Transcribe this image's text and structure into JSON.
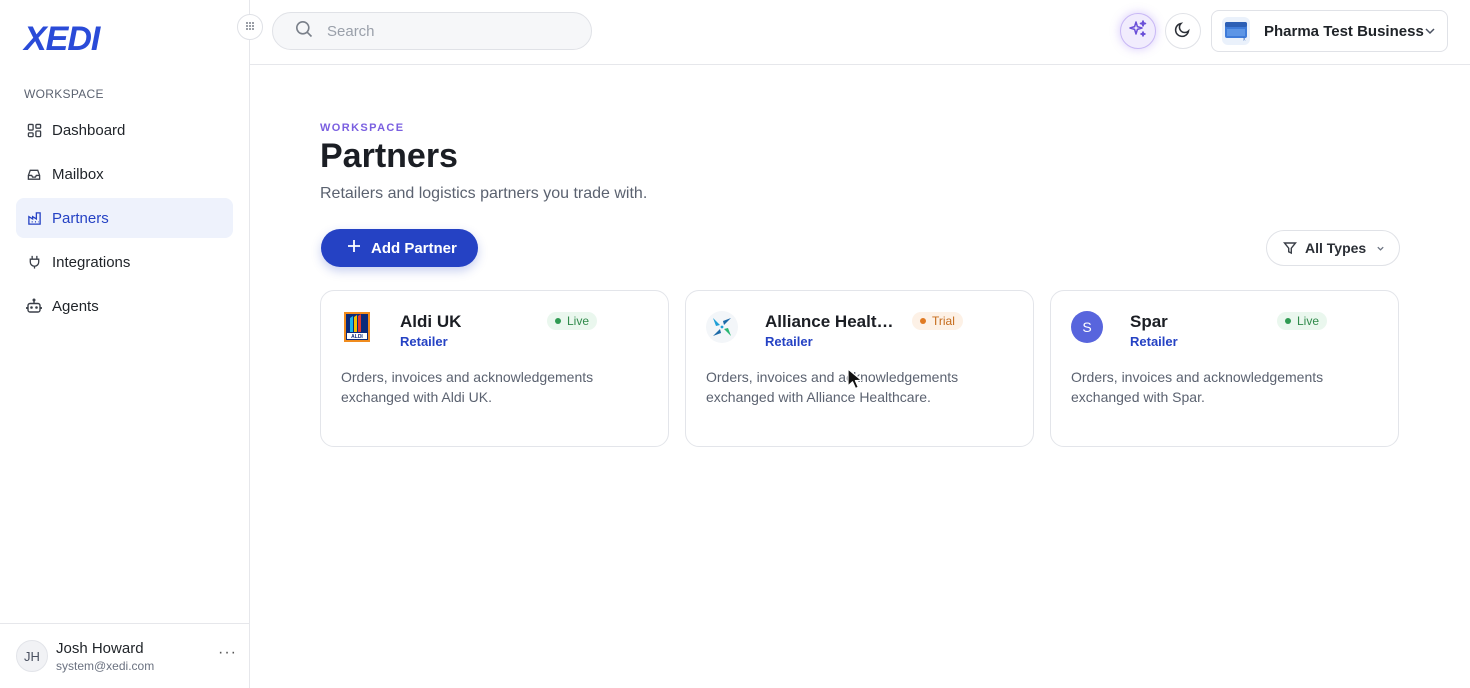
{
  "brand": {
    "logo_text": "XEDI"
  },
  "sidebar": {
    "section_label": "WORKSPACE",
    "items": [
      {
        "label": "Dashboard",
        "icon": "dashboard-icon",
        "active": false
      },
      {
        "label": "Mailbox",
        "icon": "inbox-icon",
        "active": false
      },
      {
        "label": "Partners",
        "icon": "partners-icon",
        "active": true
      },
      {
        "label": "Integrations",
        "icon": "plug-icon",
        "active": false
      },
      {
        "label": "Agents",
        "icon": "bot-icon",
        "active": false
      }
    ],
    "user": {
      "initials": "JH",
      "name": "Josh Howard",
      "email": "system@xedi.com",
      "more_label": "···"
    }
  },
  "header": {
    "search_placeholder": "Search",
    "business_name": "Pharma Test Business"
  },
  "page": {
    "eyebrow": "WORKSPACE",
    "title": "Partners",
    "subtitle": "Retailers and logistics partners you trade with.",
    "add_button_label": "Add Partner",
    "filter_label": "All Types"
  },
  "partners": [
    {
      "name": "Aldi UK",
      "type": "Retailer",
      "status": "Live",
      "description": "Orders, invoices and acknowledgements exchanged with Aldi UK.",
      "logo": "aldi-logo"
    },
    {
      "name": "Alliance Healthcare",
      "type": "Retailer",
      "status": "Trial",
      "description": "Orders, invoices and acknowledgements exchanged with Alliance Healthcare.",
      "logo": "alliance-logo"
    },
    {
      "name": "Spar",
      "type": "Retailer",
      "status": "Live",
      "description": "Orders, invoices and acknowledgements exchanged with Spar.",
      "logo_initial": "S"
    }
  ],
  "colors": {
    "accent": "#2542c4",
    "live": "#2f8a4a",
    "trial": "#c56a1a",
    "ai": "#7a5fe0"
  }
}
